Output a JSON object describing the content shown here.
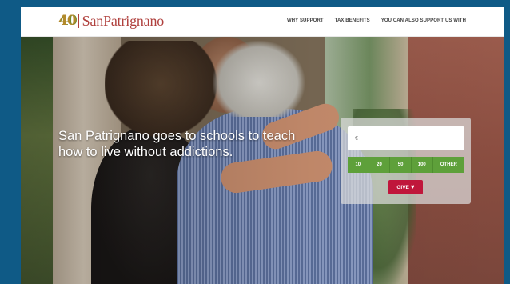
{
  "header": {
    "logo_number": "40",
    "logo_name": "SanPatrignano",
    "nav": [
      "WHY SUPPORT",
      "TAX BENEFITS",
      "YOU CAN ALSO SUPPORT US WITH"
    ]
  },
  "hero": {
    "headline": "San Patrignano goes to schools to teach how to live without addictions."
  },
  "donate": {
    "currency_symbol": "€",
    "amount_value": "",
    "amounts": [
      "10",
      "20",
      "50",
      "100",
      "OTHER"
    ],
    "give_label": "GIVE",
    "give_icon": "heart-icon"
  },
  "colors": {
    "frame": "#0f5a86",
    "brand_red": "#b0413e",
    "logo_gold": "#b28a2c",
    "amount_green": "#5ea03a",
    "give_red": "#c0163b"
  }
}
